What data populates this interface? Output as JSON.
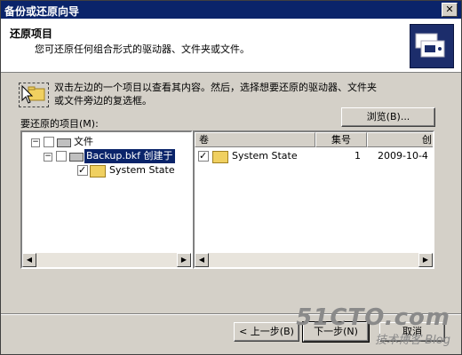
{
  "window": {
    "title": "备份或还原向导",
    "close_glyph": "✕"
  },
  "header": {
    "title": "还原项目",
    "subtitle": "您可还原任何组合形式的驱动器、文件夹或文件。",
    "icon": "backup-cards-icon"
  },
  "hint": {
    "text": "双击左边的一个项目以查看其内容。然后，选择想要还原的驱动器、文件夹或文件旁边的复选框。",
    "icon": "folder-cursor-icon"
  },
  "browse_button": "浏览(B)...",
  "items_label": "要还原的项目(M):",
  "tree": [
    {
      "label": "文件",
      "expanded": true,
      "checked": false
    },
    {
      "label": "Backup.bkf 创建于",
      "expanded": true,
      "checked": false,
      "selected": true
    },
    {
      "label": "System State",
      "checked": true
    }
  ],
  "list": {
    "columns": [
      "卷",
      "集号",
      "创"
    ],
    "rows": [
      {
        "name": "System State",
        "set": "1",
        "created": "2009-10-4",
        "checked": true
      }
    ]
  },
  "buttons": {
    "back": "< 上一步(B)",
    "next": "下一步(N)",
    "cancel": "取消"
  },
  "watermark": {
    "main": "51CTO.com",
    "sub": "技术博客  Blog"
  }
}
